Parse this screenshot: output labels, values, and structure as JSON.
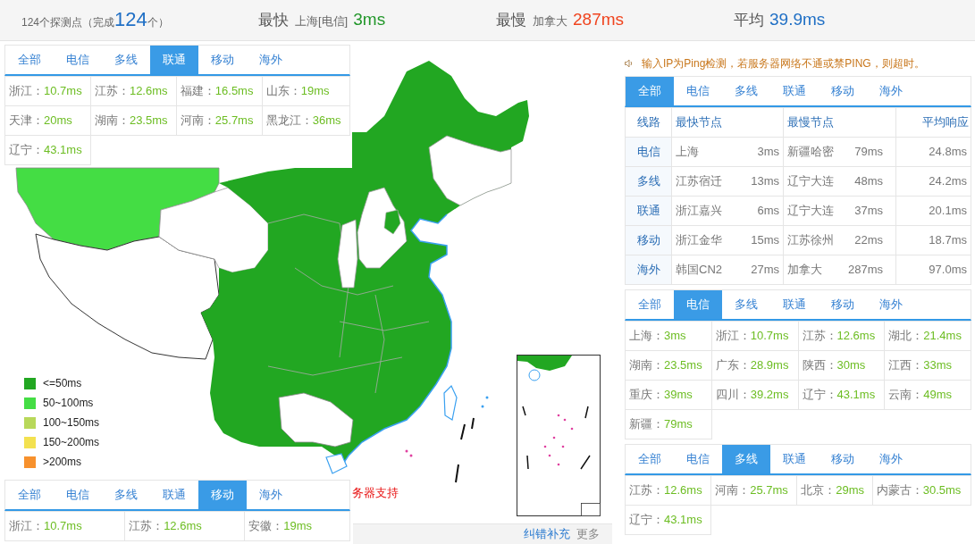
{
  "header": {
    "summary": {
      "label": "124个探测点（完成",
      "count": "124",
      "suffix": "个）"
    },
    "stats": [
      {
        "kind": "fastest",
        "label": "最快",
        "node": "上海[电信]",
        "value": "3ms"
      },
      {
        "kind": "slowest",
        "label": "最慢",
        "node": "加拿大",
        "value": "287ms"
      },
      {
        "kind": "average",
        "label": "平均",
        "value": "39.9ms"
      }
    ]
  },
  "map": {
    "legend": [
      {
        "label": "<=50ms",
        "color": "#22a722"
      },
      {
        "label": "50~100ms",
        "color": "#44dd44"
      },
      {
        "label": "100~150ms",
        "color": "#b8d85a"
      },
      {
        "label": "150~200ms",
        "color": "#f3e150"
      },
      {
        "label": ">200ms",
        "color": "#f7912d"
      }
    ],
    "caption": "务器支持",
    "footer_links": [
      {
        "kind": "link",
        "label": "纠错补充"
      },
      {
        "kind": "more",
        "label": "更多"
      }
    ]
  },
  "left_panels": [
    {
      "tabs": [
        {
          "label": "全部",
          "selected": false
        },
        {
          "label": "电信",
          "selected": false
        },
        {
          "label": "多线",
          "selected": false
        },
        {
          "label": "联通",
          "selected": true
        },
        {
          "label": "移动",
          "selected": false
        },
        {
          "label": "海外",
          "selected": false
        }
      ],
      "results": [
        {
          "region": "浙江：",
          "time": "10.7ms"
        },
        {
          "region": "江苏：",
          "time": "12.6ms"
        },
        {
          "region": "福建：",
          "time": "16.5ms"
        },
        {
          "region": "山东：",
          "time": "19ms"
        },
        {
          "region": "天津：",
          "time": "20ms"
        },
        {
          "region": "湖南：",
          "time": "23.5ms"
        },
        {
          "region": "河南：",
          "time": "25.7ms"
        },
        {
          "region": "黑龙江：",
          "time": "36ms"
        },
        {
          "region": "辽宁：",
          "time": "43.1ms"
        }
      ]
    },
    {
      "tabs": [
        {
          "label": "全部",
          "selected": false
        },
        {
          "label": "电信",
          "selected": false
        },
        {
          "label": "多线",
          "selected": false
        },
        {
          "label": "联通",
          "selected": false
        },
        {
          "label": "移动",
          "selected": true
        },
        {
          "label": "海外",
          "selected": false
        }
      ],
      "results": [
        {
          "region": "浙江：",
          "time": "10.7ms"
        },
        {
          "region": "江苏：",
          "time": "12.6ms"
        },
        {
          "region": "安徽：",
          "time": "19ms"
        }
      ]
    }
  ],
  "notice": "输入IP为Ping检测，若服务器网络不通或禁PING，则超时。",
  "summary_panel": {
    "tabs": [
      {
        "label": "全部",
        "selected": true
      },
      {
        "label": "电信",
        "selected": false
      },
      {
        "label": "多线",
        "selected": false
      },
      {
        "label": "联通",
        "selected": false
      },
      {
        "label": "移动",
        "selected": false
      },
      {
        "label": "海外",
        "selected": false
      }
    ],
    "columns": [
      "线路",
      "最快节点",
      "最慢节点",
      "平均响应"
    ],
    "rows": [
      {
        "line": "电信",
        "fastest_node": "上海",
        "fastest_time": "3ms",
        "slowest_node": "新疆哈密",
        "slowest_time": "79ms",
        "average": "24.8ms"
      },
      {
        "line": "多线",
        "fastest_node": "江苏宿迁",
        "fastest_time": "13ms",
        "slowest_node": "辽宁大连",
        "slowest_time": "48ms",
        "average": "24.2ms"
      },
      {
        "line": "联通",
        "fastest_node": "浙江嘉兴",
        "fastest_time": "6ms",
        "slowest_node": "辽宁大连",
        "slowest_time": "37ms",
        "average": "20.1ms"
      },
      {
        "line": "移动",
        "fastest_node": "浙江金华",
        "fastest_time": "15ms",
        "slowest_node": "江苏徐州",
        "slowest_time": "22ms",
        "average": "18.7ms"
      },
      {
        "line": "海外",
        "fastest_node": "韩国CN2",
        "fastest_time": "27ms",
        "slowest_node": "加拿大",
        "slowest_time": "287ms",
        "average": "97.0ms"
      }
    ]
  },
  "right_panels": [
    {
      "tabs": [
        {
          "label": "全部",
          "selected": false
        },
        {
          "label": "电信",
          "selected": true
        },
        {
          "label": "多线",
          "selected": false
        },
        {
          "label": "联通",
          "selected": false
        },
        {
          "label": "移动",
          "selected": false
        },
        {
          "label": "海外",
          "selected": false
        }
      ],
      "results": [
        {
          "region": "上海：",
          "time": "3ms"
        },
        {
          "region": "浙江：",
          "time": "10.7ms"
        },
        {
          "region": "江苏：",
          "time": "12.6ms"
        },
        {
          "region": "湖北：",
          "time": "21.4ms"
        },
        {
          "region": "湖南：",
          "time": "23.5ms"
        },
        {
          "region": "广东：",
          "time": "28.9ms"
        },
        {
          "region": "陕西：",
          "time": "30ms"
        },
        {
          "region": "江西：",
          "time": "33ms"
        },
        {
          "region": "重庆：",
          "time": "39ms"
        },
        {
          "region": "四川：",
          "time": "39.2ms"
        },
        {
          "region": "辽宁：",
          "time": "43.1ms"
        },
        {
          "region": "云南：",
          "time": "49ms"
        },
        {
          "region": "新疆：",
          "time": "79ms"
        }
      ]
    },
    {
      "tabs": [
        {
          "label": "全部",
          "selected": false
        },
        {
          "label": "电信",
          "selected": false
        },
        {
          "label": "多线",
          "selected": true
        },
        {
          "label": "联通",
          "selected": false
        },
        {
          "label": "移动",
          "selected": false
        },
        {
          "label": "海外",
          "selected": false
        }
      ],
      "results": [
        {
          "region": "江苏：",
          "time": "12.6ms"
        },
        {
          "region": "河南：",
          "time": "25.7ms"
        },
        {
          "region": "北京：",
          "time": "29ms"
        },
        {
          "region": "内蒙古：",
          "time": "30.5ms"
        },
        {
          "region": "辽宁：",
          "time": "43.1ms"
        }
      ]
    }
  ]
}
